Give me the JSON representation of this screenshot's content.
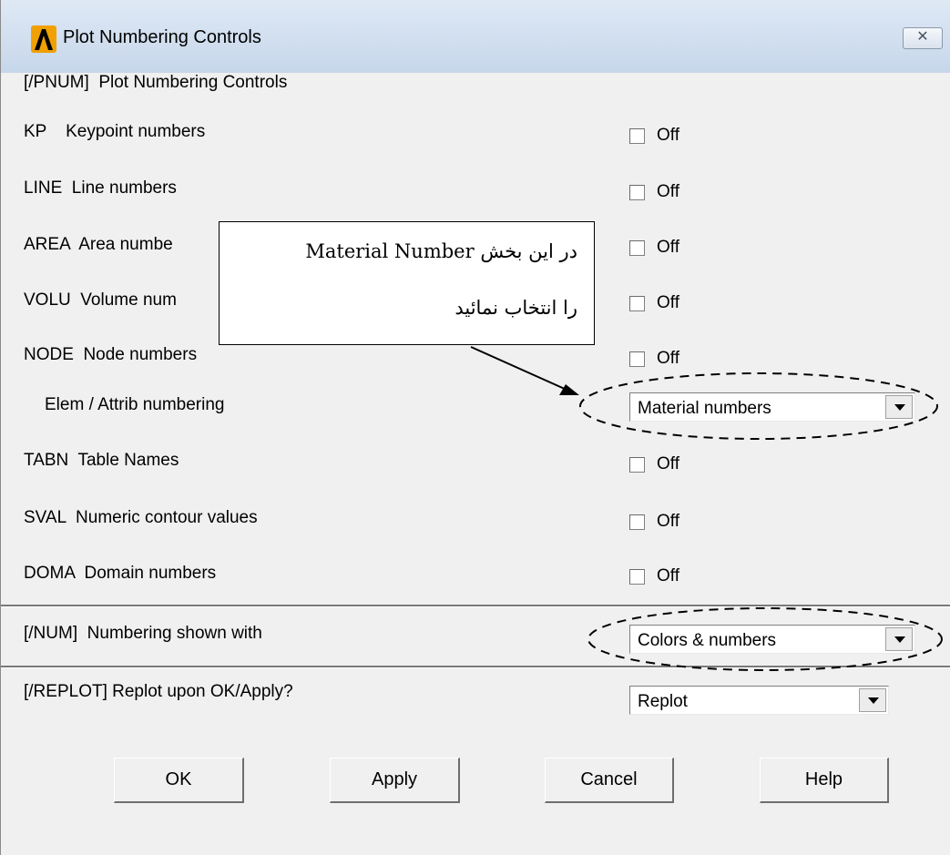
{
  "window": {
    "title": "Plot Numbering Controls",
    "close_label": "✕"
  },
  "header": {
    "label": "[/PNUM]  Plot Numbering Controls"
  },
  "rows": [
    {
      "label": "KP    Keypoint numbers",
      "state": "Off"
    },
    {
      "label": "LINE  Line numbers",
      "state": "Off"
    },
    {
      "label": "AREA  Area numbe",
      "state": "Off"
    },
    {
      "label": "VOLU  Volume num",
      "state": "Off"
    },
    {
      "label": "NODE  Node numbers",
      "state": "Off"
    }
  ],
  "elem": {
    "label": "Elem / Attrib numbering",
    "value": "Material numbers"
  },
  "rows2": [
    {
      "label": "TABN  Table Names",
      "state": "Off"
    },
    {
      "label": "SVAL  Numeric contour values",
      "state": "Off"
    },
    {
      "label": "DOMA  Domain numbers",
      "state": "Off"
    }
  ],
  "num": {
    "label": "[/NUM]  Numbering shown with",
    "value": "Colors & numbers"
  },
  "replot": {
    "label": "[/REPLOT] Replot upon OK/Apply?",
    "value": "Replot"
  },
  "buttons": {
    "ok": "OK",
    "apply": "Apply",
    "cancel": "Cancel",
    "help": "Help"
  },
  "callout": {
    "line1": "در این بخش Material Number",
    "line2": "را انتخاب نمائید"
  },
  "colors": {
    "accent": "#f0a000",
    "dialog_bg": "#f0f0f0"
  }
}
